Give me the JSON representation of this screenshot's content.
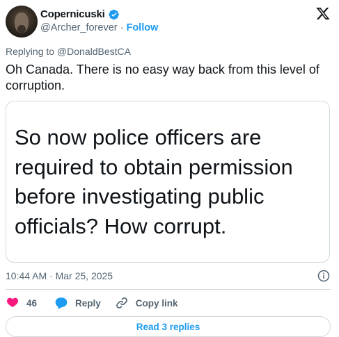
{
  "author": {
    "display_name": "Copernicuski",
    "handle": "@Archer_forever",
    "separator": "·",
    "follow_label": "Follow"
  },
  "replying_to": {
    "text": "Replying to @DonaldBestCA"
  },
  "tweet": {
    "text": "Oh Canada. There is no easy way back from this level of corruption.",
    "quoted_image_text": "So now police officers are required to obtain permission before investigating public officials? How corrupt.",
    "timestamp": "10:44 AM · Mar 25, 2025"
  },
  "actions": {
    "like_count": "46",
    "reply_label": "Reply",
    "copy_link_label": "Copy link"
  },
  "footer": {
    "read_replies_label": "Read 3 replies"
  },
  "colors": {
    "accent": "#1d9bf0",
    "like": "#f91880",
    "muted": "#536471",
    "border": "#cfd9de"
  },
  "icons": [
    "verified-badge-icon",
    "x-logo-icon",
    "info-icon",
    "heart-icon",
    "reply-bubble-icon",
    "link-icon"
  ]
}
